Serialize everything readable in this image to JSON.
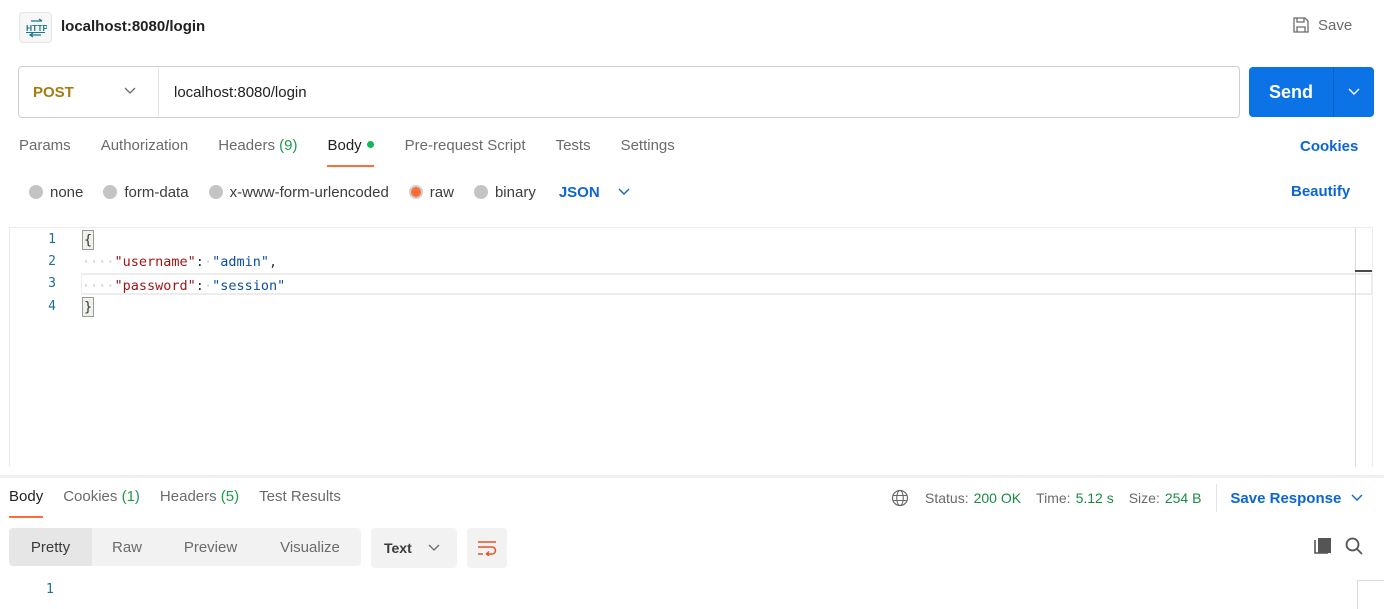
{
  "header": {
    "icon": "http-icon",
    "title": "localhost:8080/login",
    "save_label": "Save"
  },
  "request": {
    "method": "POST",
    "url": "localhost:8080/login",
    "send_label": "Send"
  },
  "request_tabs": [
    {
      "label": "Params",
      "active": false
    },
    {
      "label": "Authorization",
      "active": false
    },
    {
      "label": "Headers",
      "count": "(9)",
      "active": false
    },
    {
      "label": "Body",
      "active": true,
      "indicator": "green-dot"
    },
    {
      "label": "Pre-request Script",
      "active": false
    },
    {
      "label": "Tests",
      "active": false
    },
    {
      "label": "Settings",
      "active": false
    }
  ],
  "cookies_label": "Cookies",
  "body_types": [
    {
      "label": "none",
      "selected": false
    },
    {
      "label": "form-data",
      "selected": false
    },
    {
      "label": "x-www-form-urlencoded",
      "selected": false
    },
    {
      "label": "raw",
      "selected": true
    },
    {
      "label": "binary",
      "selected": false
    }
  ],
  "body_format": "JSON",
  "beautify_label": "Beautify",
  "editor": {
    "line_numbers": [
      "1",
      "2",
      "3",
      "4"
    ],
    "lines": {
      "l1": "{",
      "l2_ws": "····",
      "l2_key": "\"username\"",
      "l2_colon": ":",
      "l2_sp": "·",
      "l2_val": "\"admin\"",
      "l2_comma": ",",
      "l3_ws": "····",
      "l3_key": "\"password\"",
      "l3_colon": ":",
      "l3_sp": "·",
      "l3_val": "\"session\"",
      "l4": "}"
    }
  },
  "response": {
    "tabs": [
      {
        "label": "Body",
        "active": true
      },
      {
        "label": "Cookies",
        "count": "(1)",
        "active": false
      },
      {
        "label": "Headers",
        "count": "(5)",
        "active": false
      },
      {
        "label": "Test Results",
        "active": false
      }
    ],
    "status_label": "Status:",
    "status_value": "200 OK",
    "time_label": "Time:",
    "time_value": "5.12 s",
    "size_label": "Size:",
    "size_value": "254 B",
    "save_response_label": "Save Response",
    "views": [
      "Pretty",
      "Raw",
      "Preview",
      "Visualize"
    ],
    "active_view": "Pretty",
    "format": "Text",
    "line_numbers": [
      "1"
    ]
  },
  "colors": {
    "accent_orange": "#ff6c37",
    "send_blue": "#0b73e6",
    "link_blue": "#0b66d4",
    "method_post": "#a77c0f",
    "success_green": "#1c8a43"
  }
}
